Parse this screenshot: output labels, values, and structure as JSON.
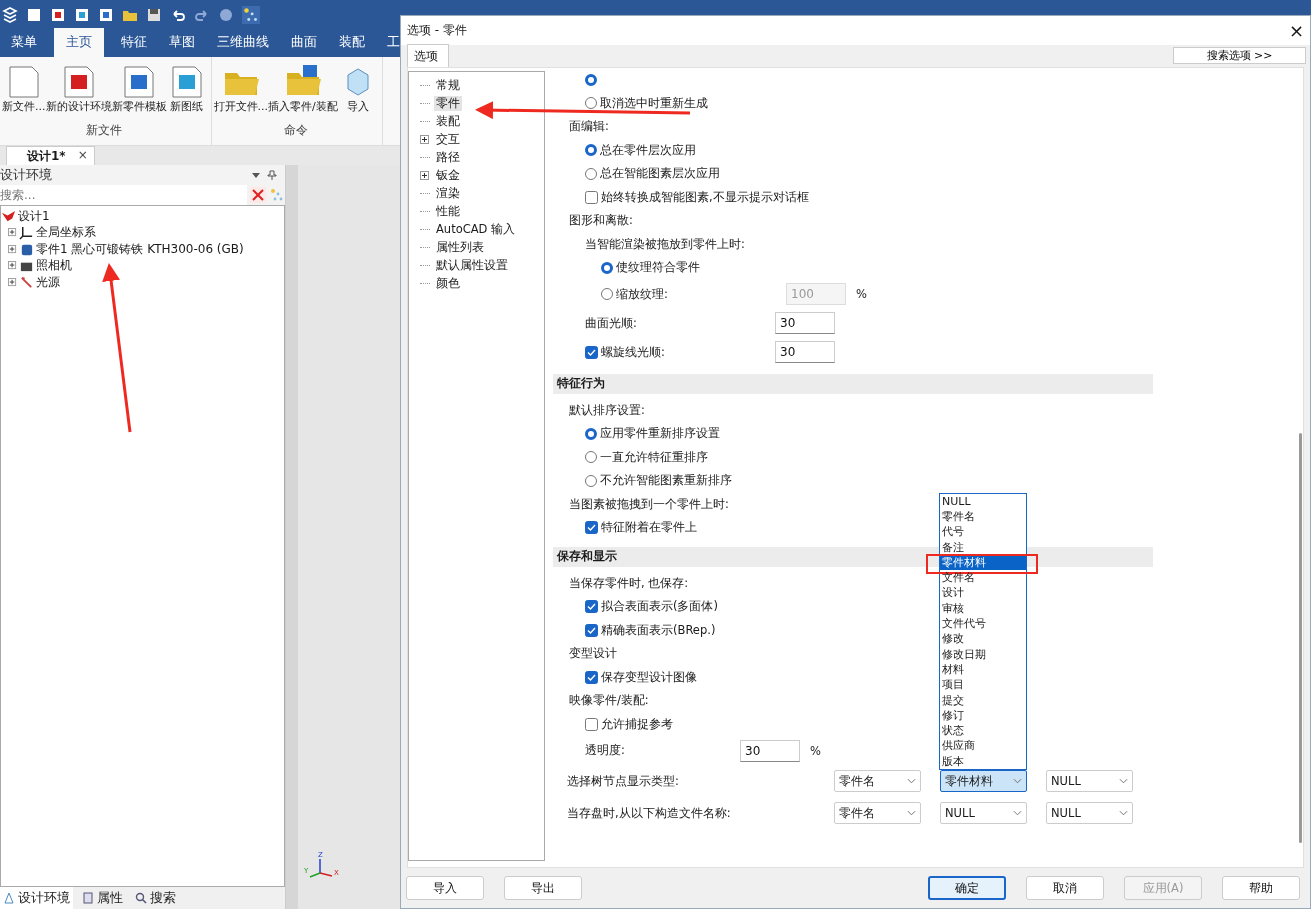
{
  "app": {
    "quick_access": [
      {
        "kind": "logo"
      },
      {
        "kind": "blank"
      },
      {
        "kind": "env"
      },
      {
        "kind": "drawing"
      },
      {
        "kind": "template"
      },
      {
        "kind": "folder"
      },
      {
        "kind": "save"
      },
      {
        "kind": "undo"
      },
      {
        "kind": "redo"
      },
      {
        "kind": "ball"
      },
      {
        "kind": "tree"
      }
    ],
    "ribbon_tabs": [
      {
        "label": "菜单",
        "selected": false
      },
      {
        "label": "主页",
        "selected": true
      },
      {
        "label": "特征",
        "selected": false
      },
      {
        "label": "草图",
        "selected": false
      },
      {
        "label": "三维曲线",
        "selected": false
      },
      {
        "label": "曲面",
        "selected": false
      },
      {
        "label": "装配",
        "selected": false
      },
      {
        "label": "工",
        "selected": false
      }
    ],
    "ribbon_groups": [
      {
        "label": "新文件",
        "buttons": [
          {
            "label": "新文件...",
            "kind": "blank"
          },
          {
            "label": "新的设计环境",
            "kind": "env"
          },
          {
            "label": "新零件模板",
            "kind": "template"
          },
          {
            "label": "新图纸",
            "kind": "drawing"
          }
        ]
      },
      {
        "label": "命令",
        "buttons": [
          {
            "label": "打开文件...",
            "kind": "folder"
          },
          {
            "label": "插入零件/装配",
            "kind": "insert"
          },
          {
            "label": "导入",
            "kind": "cube"
          }
        ]
      }
    ],
    "document_tab": {
      "label": "设计1*",
      "close": "×"
    },
    "panel": {
      "title": "设计环境",
      "search": {
        "placeholder": "搜索..."
      },
      "tree": [
        {
          "label": "设计1",
          "kind": "design",
          "children": [
            {
              "label": "全局坐标系",
              "kind": "axes",
              "expanded": false
            },
            {
              "label": "零件1 黑心可锻铸铁 KTH300-06 (GB)",
              "kind": "part",
              "expanded": false
            },
            {
              "label": "照相机",
              "kind": "camera",
              "expanded": false
            },
            {
              "label": "光源",
              "kind": "light",
              "expanded": false
            }
          ]
        }
      ]
    },
    "bottom_tabs": [
      {
        "label": "设计环境",
        "kind": "env",
        "selected": true
      },
      {
        "label": "属性",
        "kind": "props",
        "selected": false
      },
      {
        "label": "搜索",
        "kind": "search",
        "selected": false
      }
    ],
    "axis_labels": [
      "Z",
      "Y",
      "X"
    ]
  },
  "dialog": {
    "title": "选项 - 零件",
    "close": "×",
    "tab": "选项",
    "search_button": "搜索选项 >>",
    "nav": [
      {
        "label": "常规",
        "selected": false,
        "expandable": false
      },
      {
        "label": "零件",
        "selected": true,
        "expandable": false
      },
      {
        "label": "装配",
        "selected": false,
        "expandable": false
      },
      {
        "label": "交互",
        "selected": false,
        "expandable": true
      },
      {
        "label": "路径",
        "selected": false,
        "expandable": false
      },
      {
        "label": "钣金",
        "selected": false,
        "expandable": true
      },
      {
        "label": "渲染",
        "selected": false,
        "expandable": false
      },
      {
        "label": "性能",
        "selected": false,
        "expandable": false
      },
      {
        "label": "AutoCAD 输入",
        "selected": false,
        "expandable": false
      },
      {
        "label": "属性列表",
        "selected": false,
        "expandable": false
      },
      {
        "label": "默认属性设置",
        "selected": false,
        "expandable": false
      },
      {
        "label": "颜色",
        "selected": false,
        "expandable": false
      }
    ],
    "content": [
      {
        "kind": "group",
        "children": [
          {
            "kind": "radio",
            "selected": true
          },
          {
            "kind": "radio",
            "label": "取消选中时重新生成",
            "selected": false
          }
        ]
      },
      {
        "kind": "group",
        "label": "面编辑:",
        "children": [
          {
            "kind": "radio",
            "label": "总在零件层次应用",
            "selected": true
          },
          {
            "kind": "radio",
            "label": "总在智能图素层次应用",
            "selected": false
          },
          {
            "kind": "checkbox",
            "label": "始终转换成智能图素,不显示提示对话框",
            "checked": false
          }
        ]
      },
      {
        "kind": "group",
        "label": "图形和离散:",
        "children": [
          {
            "kind": "group",
            "label": "当智能渲染被拖放到零件上时:",
            "children": [
              {
                "kind": "radio",
                "label": "使纹理符合零件",
                "selected": true
              },
              {
                "kind": "radio",
                "label": "缩放纹理:",
                "selected": false,
                "field": {
                  "value": "100",
                  "disabled": true,
                  "unit": "%"
                }
              }
            ]
          },
          {
            "kind": "field",
            "label": "曲面光顺:",
            "field": {
              "value": "30",
              "disabled": false
            }
          },
          {
            "kind": "checkbox",
            "label": "螺旋线光顺:",
            "checked": true,
            "field": {
              "value": "30",
              "disabled": false
            }
          }
        ]
      },
      {
        "kind": "section",
        "label": "特征行为"
      },
      {
        "kind": "group",
        "label": "默认排序设置:",
        "children": [
          {
            "kind": "radio",
            "label": "应用零件重新排序设置",
            "selected": true
          },
          {
            "kind": "radio",
            "label": "一直允许特征重排序",
            "selected": false
          },
          {
            "kind": "radio",
            "label": "不允许智能图素重新排序",
            "selected": false
          }
        ]
      },
      {
        "kind": "group",
        "label": "当图素被拖拽到一个零件上时:",
        "children": [
          {
            "kind": "checkbox",
            "label": "特征附着在零件上",
            "checked": true
          }
        ]
      },
      {
        "kind": "section",
        "label": "保存和显示"
      },
      {
        "kind": "group",
        "label": "当保存零件时, 也保存:",
        "children": [
          {
            "kind": "checkbox",
            "label": "拟合表面表示(多面体)",
            "checked": true
          },
          {
            "kind": "checkbox",
            "label": "精确表面表示(BRep.)",
            "checked": true
          }
        ]
      },
      {
        "kind": "group",
        "label": "变型设计",
        "children": [
          {
            "kind": "checkbox",
            "label": "保存变型设计图像",
            "checked": true
          }
        ]
      },
      {
        "kind": "group",
        "label": "映像零件/装配:",
        "children": [
          {
            "kind": "checkbox",
            "label": "允许捕捉参考",
            "checked": false
          },
          {
            "kind": "field",
            "label": "透明度:",
            "field": {
              "value": "30",
              "disabled": false,
              "unit": "%"
            }
          }
        ]
      },
      {
        "kind": "selects",
        "label": "选择树节点显示类型:",
        "selects": [
          {
            "value": "零件名",
            "open": false
          },
          {
            "value": "零件材料",
            "open": true
          },
          {
            "value": "NULL",
            "open": false
          }
        ]
      },
      {
        "kind": "selects",
        "label": "当存盘时,从以下构造文件名称:",
        "selects": [
          {
            "value": "零件名",
            "open": false
          },
          {
            "value": "NULL",
            "open": false
          },
          {
            "value": "NULL",
            "open": false
          }
        ]
      }
    ],
    "dropdown_options": [
      {
        "label": "NULL",
        "selected": false
      },
      {
        "label": "零件名",
        "selected": false
      },
      {
        "label": "代号",
        "selected": false
      },
      {
        "label": "备注",
        "selected": false
      },
      {
        "label": "零件材料",
        "selected": true
      },
      {
        "label": "文件名",
        "selected": false
      },
      {
        "label": "设计",
        "selected": false
      },
      {
        "label": "审核",
        "selected": false
      },
      {
        "label": "文件代号",
        "selected": false
      },
      {
        "label": "修改",
        "selected": false
      },
      {
        "label": "修改日期",
        "selected": false
      },
      {
        "label": "材料",
        "selected": false
      },
      {
        "label": "项目",
        "selected": false
      },
      {
        "label": "提交",
        "selected": false
      },
      {
        "label": "修订",
        "selected": false
      },
      {
        "label": "状态",
        "selected": false
      },
      {
        "label": "供应商",
        "selected": false
      },
      {
        "label": "版本",
        "selected": false
      }
    ],
    "left_buttons": [
      {
        "label": "导入",
        "default": false,
        "disabled": false
      },
      {
        "label": "导出",
        "default": false,
        "disabled": false
      }
    ],
    "right_buttons": [
      {
        "label": "确定",
        "default": true,
        "disabled": false
      },
      {
        "label": "取消",
        "default": false,
        "disabled": false
      },
      {
        "label": "应用(A)",
        "default": false,
        "disabled": true
      },
      {
        "label": "帮助",
        "default": false,
        "disabled": false
      }
    ]
  }
}
